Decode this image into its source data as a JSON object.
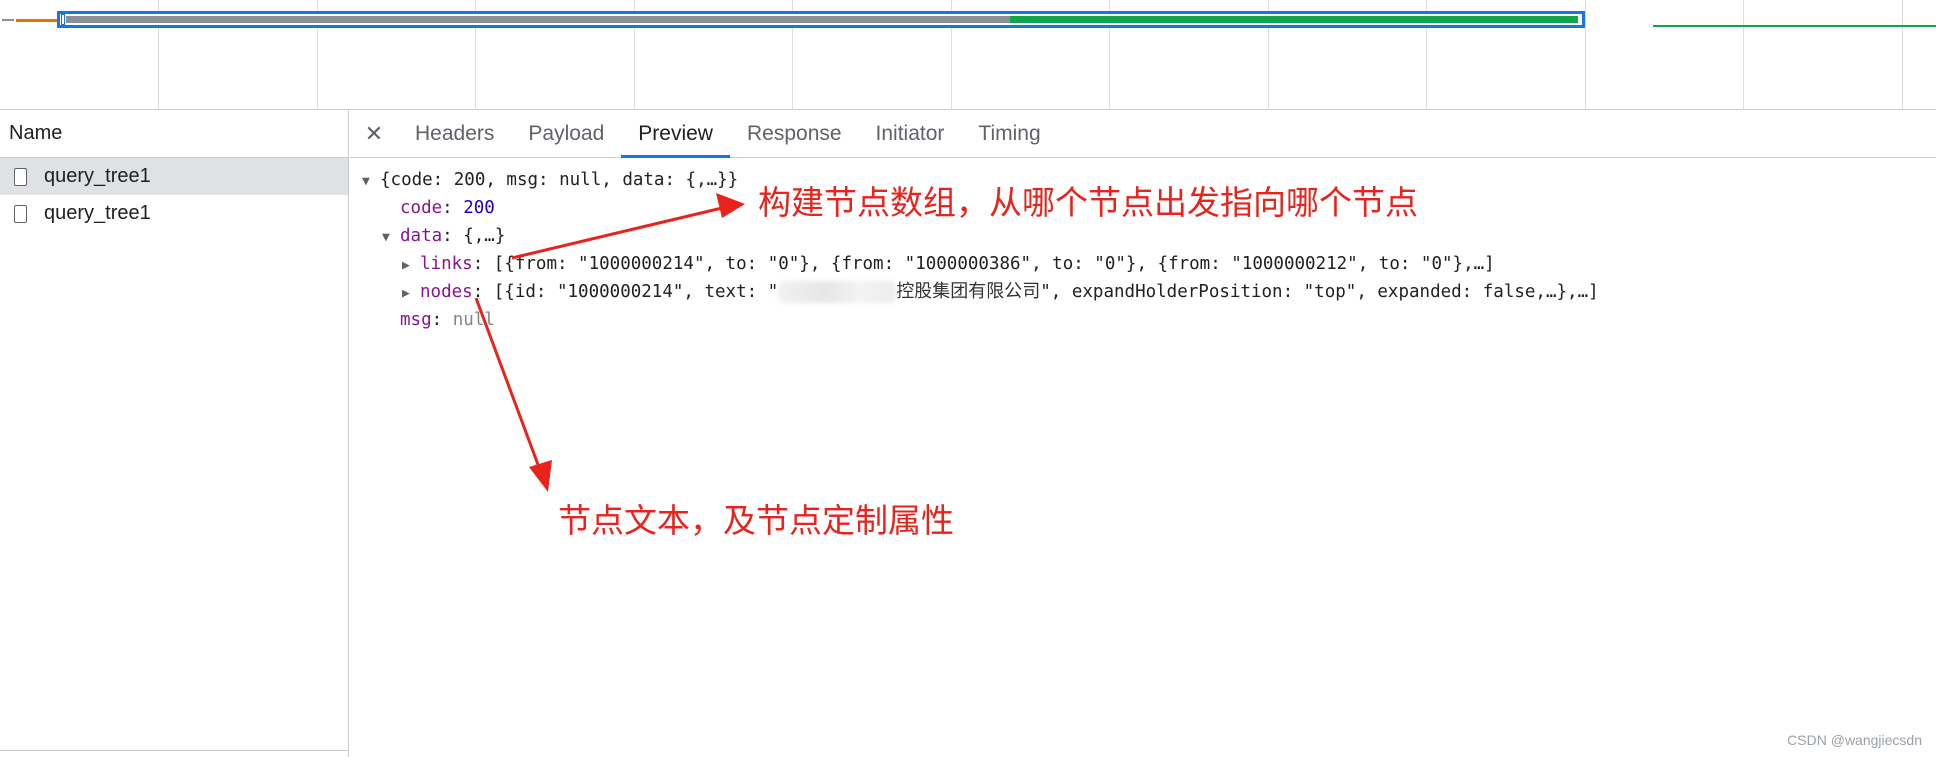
{
  "left_pane": {
    "header": "Name",
    "requests": [
      {
        "name": "query_tree1",
        "selected": true
      },
      {
        "name": "query_tree1",
        "selected": false
      }
    ]
  },
  "tabs": {
    "close_icon": "close-icon",
    "items": [
      "Headers",
      "Payload",
      "Preview",
      "Response",
      "Initiator",
      "Timing"
    ],
    "active": "Preview"
  },
  "preview": {
    "root": "{code: 200, msg: null, data: {,…}}",
    "code_key": "code",
    "code_value": "200",
    "data_key": "data",
    "data_summary": "{,…}",
    "links_key": "links",
    "links_value": "[{from: \"1000000214\", to: \"0\"}, {from: \"1000000386\", to: \"0\"}, {from: \"1000000212\", to: \"0\"},…]",
    "nodes_key": "nodes",
    "nodes_prefix": "[{id: \"1000000214\", text: \"",
    "nodes_text_visible": "控股集团有限公司",
    "nodes_suffix": "\", expandHolderPosition: \"top\", expanded: false,…},…]",
    "msg_key": "msg",
    "msg_value": "null"
  },
  "annotations": {
    "top": "构建节点数组，从哪个节点出发指向哪个节点",
    "bottom": "节点文本，及节点定制属性",
    "color": "#e8231b"
  },
  "watermark": "CSDN @wangjiecsdn",
  "colors": {
    "tab_active_underline": "#1a73e8",
    "timeline_selection": "#1a73e8",
    "timeline_waiting": "#8a8f98",
    "timeline_download": "#0fa54b",
    "timeline_orange": "#e8710a"
  }
}
